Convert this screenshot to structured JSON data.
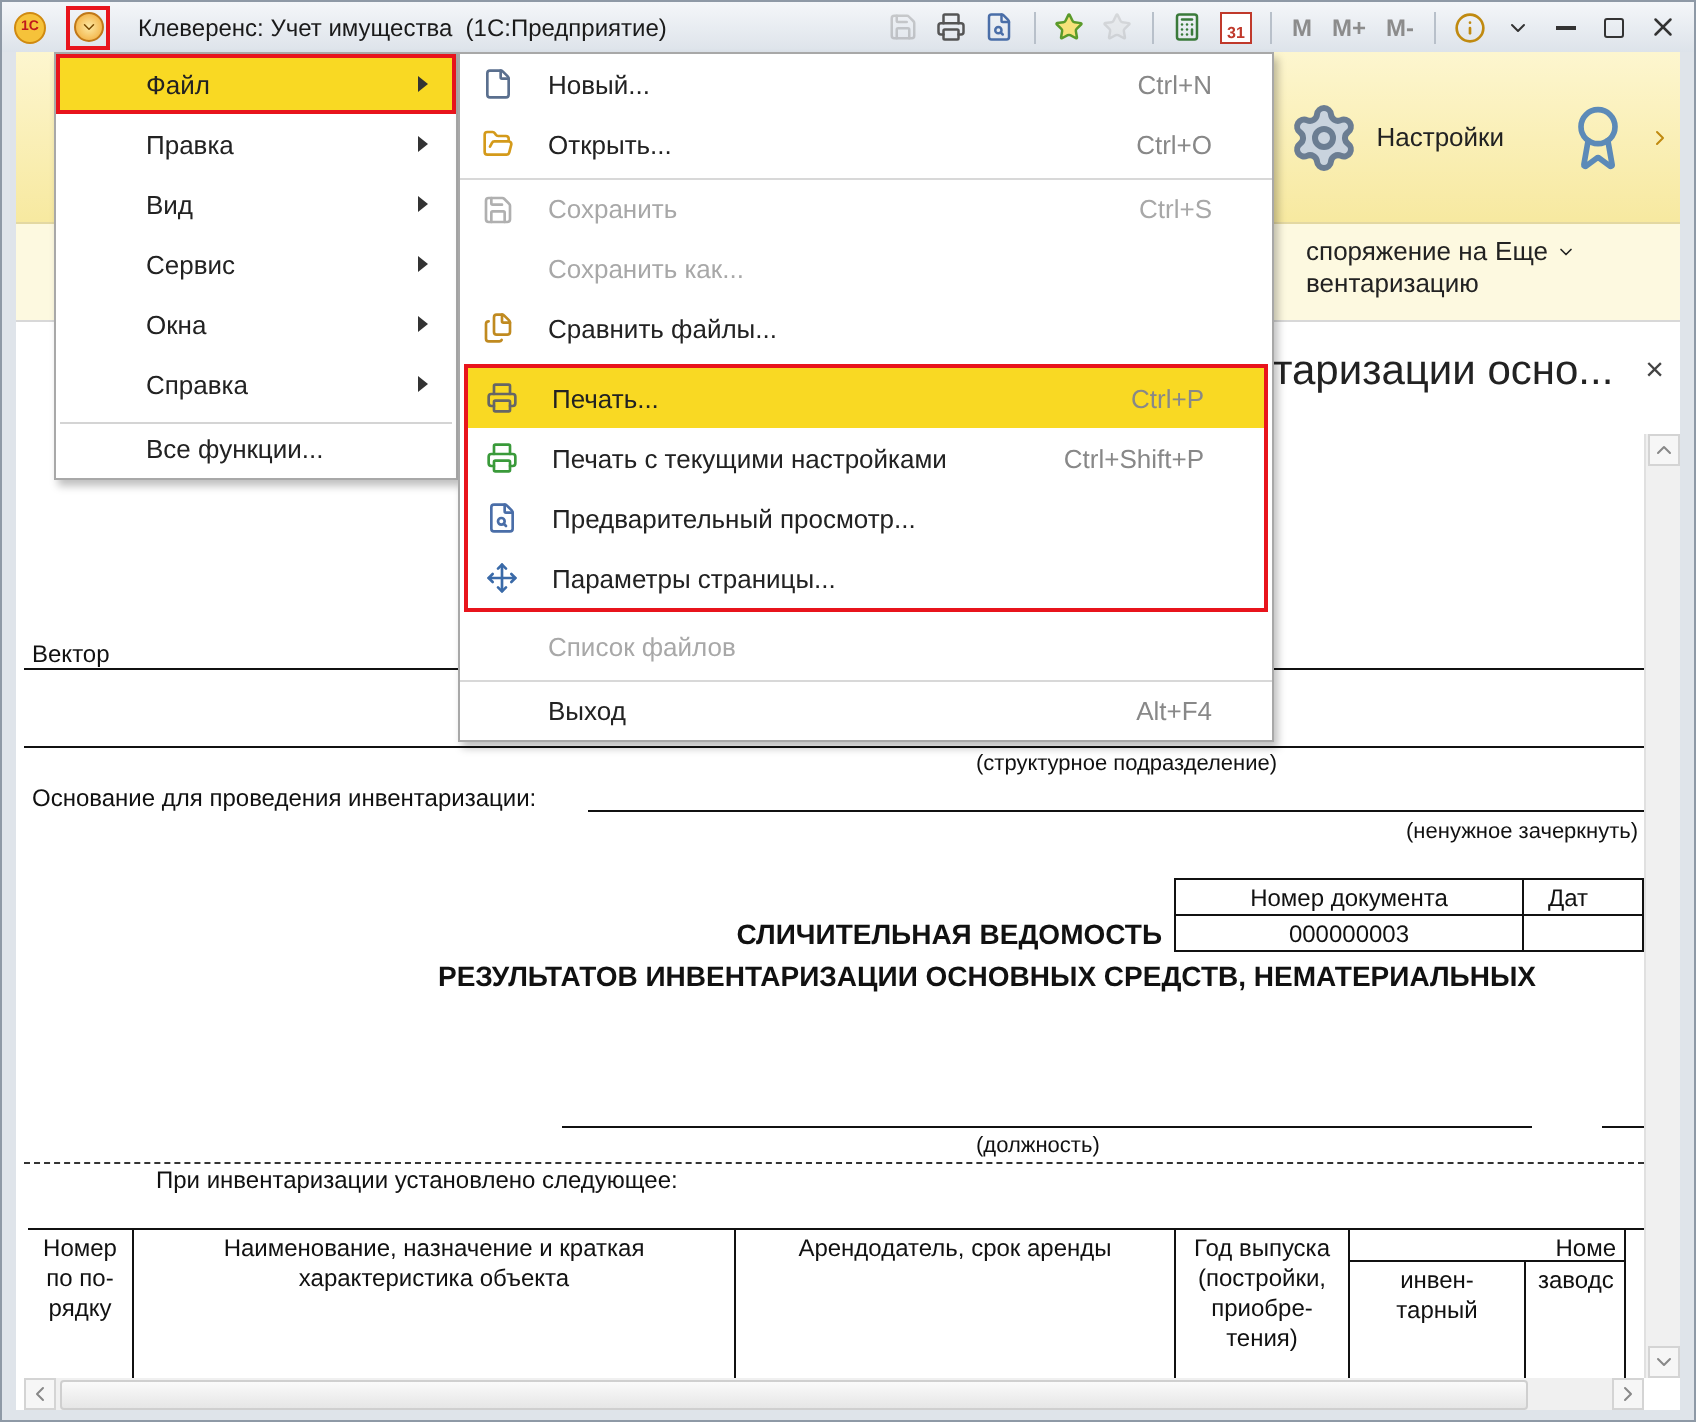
{
  "window": {
    "logo_text": "1С",
    "title": "Клеверенс: Учет имущества  (1С:Предприятие)",
    "main_menu_button": {
      "highlighted": true
    },
    "toolbar": [
      {
        "kind": "save",
        "disabled": true
      },
      {
        "kind": "print",
        "disabled": false
      },
      {
        "kind": "preview",
        "disabled": false
      },
      {
        "kind": "separator"
      },
      {
        "kind": "favorite-add",
        "disabled": false
      },
      {
        "kind": "favorite",
        "disabled": true
      },
      {
        "kind": "separator"
      },
      {
        "kind": "calculator",
        "disabled": false
      },
      {
        "kind": "calendar",
        "disabled": false,
        "label": "31"
      },
      {
        "kind": "separator"
      },
      {
        "kind": "memory",
        "disabled": true,
        "label": "M"
      },
      {
        "kind": "memory",
        "disabled": true,
        "label": "M+"
      },
      {
        "kind": "memory",
        "disabled": true,
        "label": "M-"
      },
      {
        "kind": "separator"
      },
      {
        "kind": "info",
        "disabled": false
      },
      {
        "kind": "caret",
        "disabled": false
      },
      {
        "kind": "minimize",
        "disabled": false
      },
      {
        "kind": "maximize",
        "disabled": false
      },
      {
        "kind": "close",
        "disabled": false
      }
    ]
  },
  "section_panel": {
    "items": [
      {
        "kind": "gear",
        "label": "Настройки"
      },
      {
        "kind": "certificate"
      }
    ]
  },
  "command_bar": {
    "right_button": "споряжение на\nвентаризацию",
    "more": "Еще"
  },
  "form": {
    "title": "таризации осно...",
    "close": "×"
  },
  "menu": {
    "items": [
      {
        "label": "Файл",
        "kind": "submenu",
        "selected": true,
        "highlighted": true,
        "divider": false
      },
      {
        "label": "Правка",
        "kind": "submenu",
        "selected": false,
        "highlighted": false,
        "divider": false
      },
      {
        "label": "Вид",
        "kind": "submenu",
        "selected": false,
        "highlighted": false,
        "divider": false
      },
      {
        "label": "Сервис",
        "kind": "submenu",
        "selected": false,
        "highlighted": false,
        "divider": false
      },
      {
        "label": "Окна",
        "kind": "submenu",
        "selected": false,
        "highlighted": false,
        "divider": false
      },
      {
        "label": "Справка",
        "kind": "submenu",
        "selected": false,
        "highlighted": false,
        "divider": false
      },
      {
        "label": "Все функции...",
        "kind": "command",
        "selected": false,
        "highlighted": false,
        "divider": true
      }
    ]
  },
  "submenu": {
    "groups": [
      {
        "divider": false,
        "highlighted": false,
        "items": [
          {
            "kind": "new",
            "label": "Новый...",
            "shortcut": "Ctrl+N",
            "disabled": false,
            "selected": false
          },
          {
            "kind": "open",
            "label": "Открыть...",
            "shortcut": "Ctrl+O",
            "disabled": false,
            "selected": false
          }
        ]
      },
      {
        "divider": true,
        "highlighted": false,
        "items": [
          {
            "kind": "save",
            "label": "Сохранить",
            "shortcut": "Ctrl+S",
            "disabled": true,
            "selected": false
          },
          {
            "kind": "plain",
            "label": "Сохранить как...",
            "disabled": true,
            "selected": false
          },
          {
            "kind": "compare",
            "label": "Сравнить файлы...",
            "disabled": false,
            "selected": false
          }
        ]
      },
      {
        "divider": false,
        "highlighted": true,
        "items": [
          {
            "kind": "print",
            "label": "Печать...",
            "shortcut": "Ctrl+P",
            "disabled": false,
            "selected": true
          },
          {
            "kind": "print-settings",
            "label": "Печать с текущими настройками",
            "shortcut": "Ctrl+Shift+P",
            "disabled": false,
            "selected": false
          },
          {
            "kind": "preview",
            "label": "Предварительный просмотр...",
            "disabled": false,
            "selected": false
          },
          {
            "kind": "page-setup",
            "label": "Параметры страницы...",
            "disabled": false,
            "selected": false
          }
        ]
      },
      {
        "divider": false,
        "highlighted": false,
        "items": [
          {
            "kind": "plain",
            "label": "Список файлов",
            "disabled": true,
            "selected": false
          }
        ]
      },
      {
        "divider": true,
        "highlighted": false,
        "items": [
          {
            "kind": "plain",
            "label": "Выход",
            "shortcut": "Alt+F4",
            "disabled": false,
            "selected": false
          }
        ]
      }
    ]
  },
  "document": {
    "org": "Вектор",
    "unit_caption": "(структурное подразделение)",
    "basis_label": "Основание для проведения инвентаризации:",
    "basis_note": "(ненужное зачеркнуть)",
    "doc_number_header": "Номер документа",
    "doc_date_header": "Дат",
    "doc_number": "000000003",
    "title_1": "СЛИЧИТЕЛЬНАЯ ВЕДОМОСТЬ",
    "title_2": "РЕЗУЛЬТАТОВ ИНВЕНТАРИЗАЦИИ ОСНОВНЫХ СРЕДСТВ, НЕМАТЕРИАЛЬНЫХ",
    "position_caption": "(должность)",
    "found_text": "При инвентаризации установлено следующее:",
    "table": {
      "columns": [
        "Номер\nпо по-\nрядку",
        "Наименование, назначение и краткая\nхарактеристика объекта",
        "Арендодатель, срок аренды",
        "Год выпуска\n(постройки,\nприобре-\nтения)"
      ],
      "number_group": "Номе",
      "number_subcolumns": [
        "инвен-\nтарный",
        "заводс"
      ]
    }
  }
}
